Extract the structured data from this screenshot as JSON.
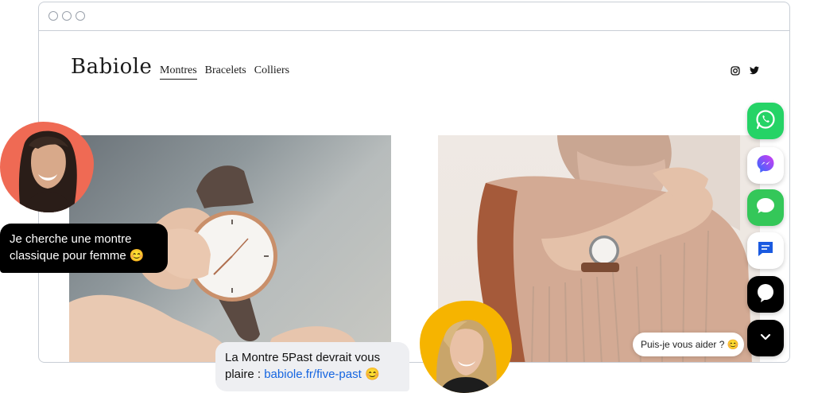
{
  "site": {
    "logo": "Babiole",
    "nav": [
      {
        "label": "Montres",
        "active": true
      },
      {
        "label": "Bracelets",
        "active": false
      },
      {
        "label": "Colliers",
        "active": false
      }
    ],
    "social_icons": [
      "instagram-icon",
      "twitter-icon"
    ]
  },
  "chat": {
    "customer_message_line1": "Je cherche une montre",
    "customer_message_line2": "classique pour femme",
    "customer_emoji": "😊",
    "agent_message_line1": "La Montre 5Past devrait vous",
    "agent_message_prefix": "plaire : ",
    "agent_link": "babiole.fr/five-past",
    "agent_emoji": "😊",
    "help_prompt": "Puis-je vous aider ?",
    "help_emoji": "😊"
  },
  "channels": [
    {
      "name": "whatsapp-icon",
      "color": "#25d366"
    },
    {
      "name": "messenger-icon",
      "color": "#ffffff"
    },
    {
      "name": "imessage-icon",
      "color": "#34c759"
    },
    {
      "name": "chat-icon",
      "color": "#ffffff"
    },
    {
      "name": "livechat-icon",
      "color": "#000000"
    },
    {
      "name": "chevron-down-icon",
      "color": "#000000"
    }
  ],
  "colors": {
    "avatar_customer_bg": "#ef6a54",
    "avatar_agent_bg": "#f6b400",
    "link": "#1565e0"
  }
}
